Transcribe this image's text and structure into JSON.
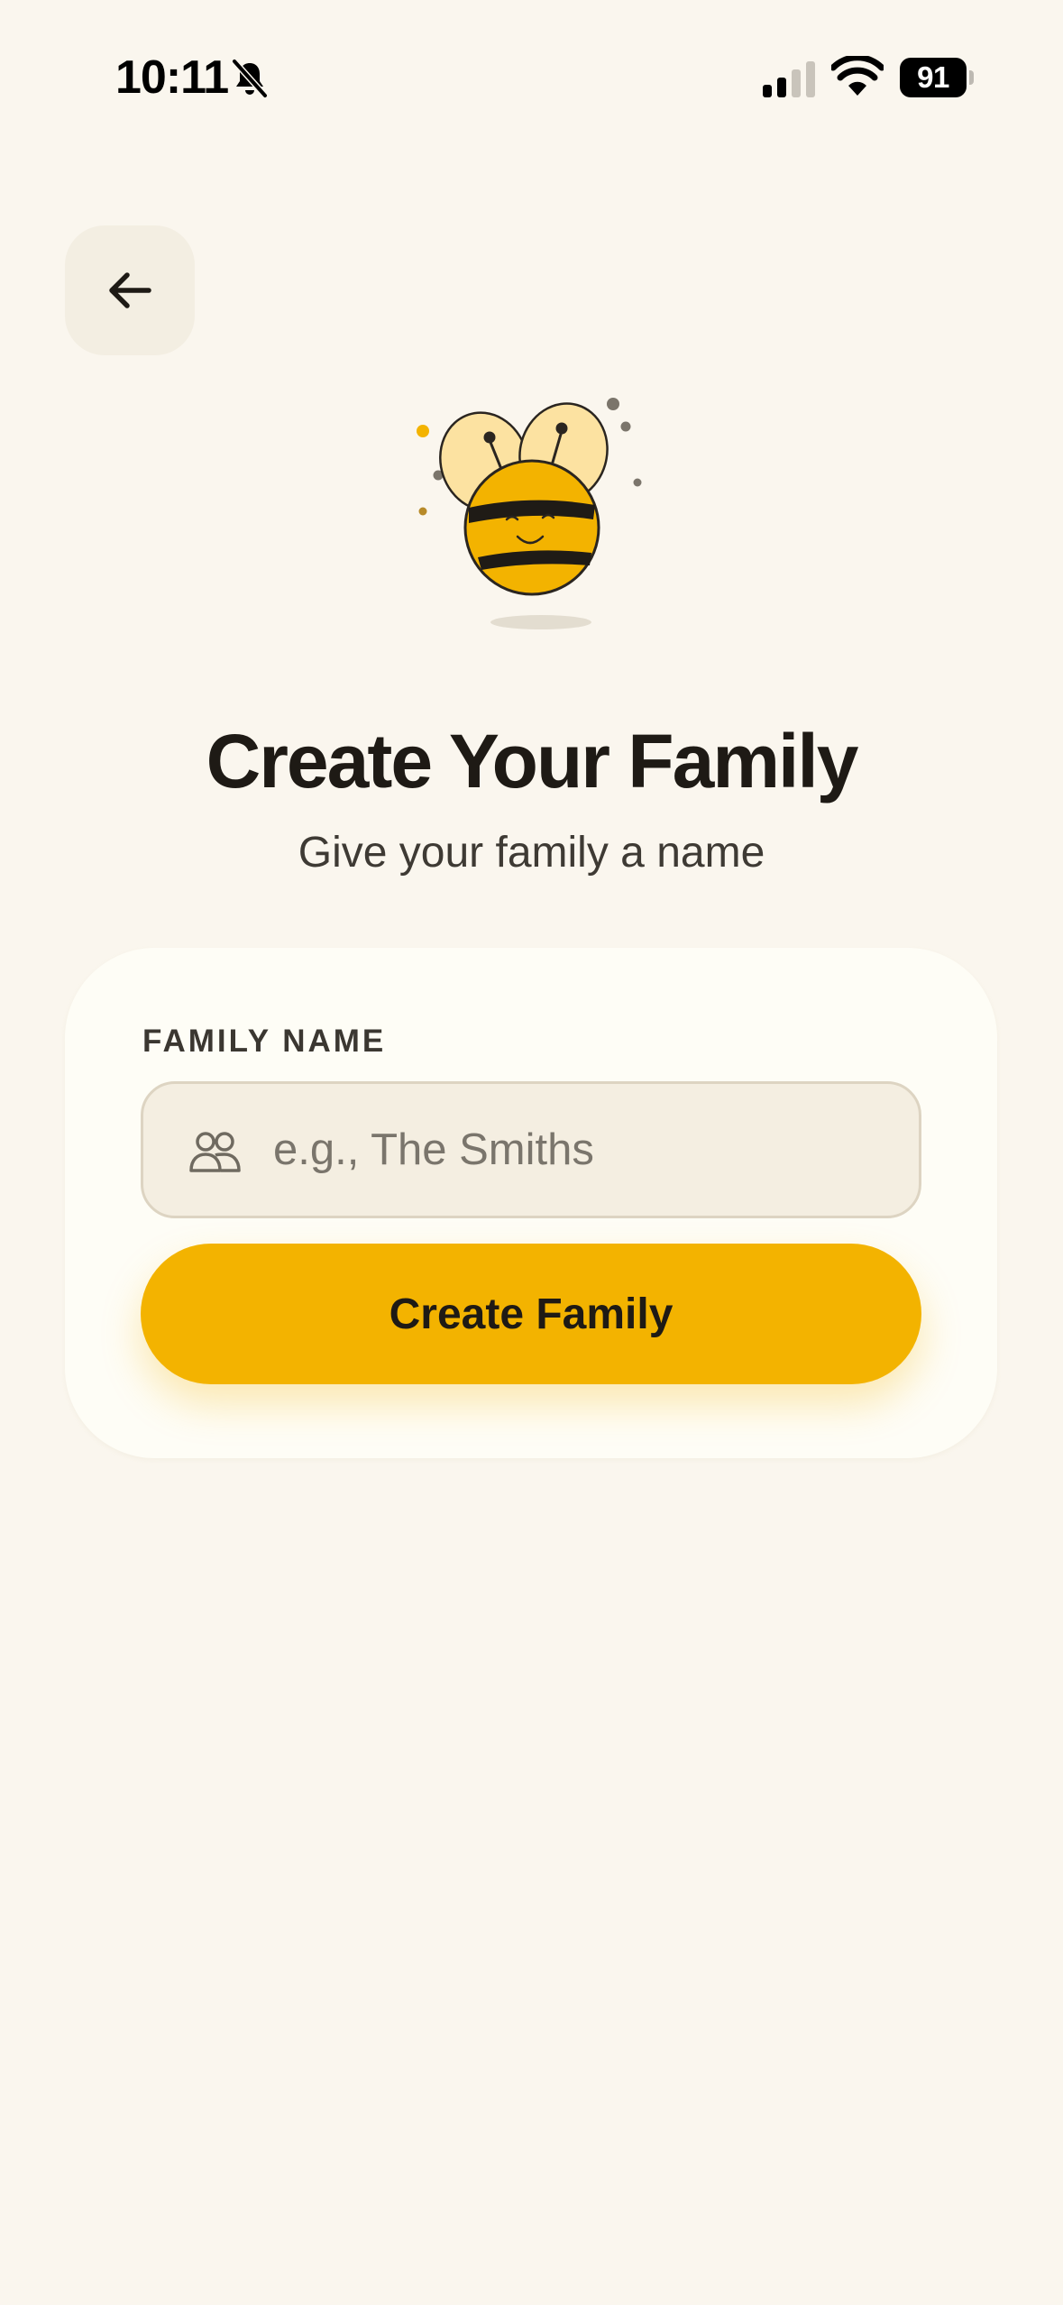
{
  "status_bar": {
    "time": "10:11",
    "battery_level": "91",
    "icons": [
      "bell-slash-icon",
      "cellular-signal-icon",
      "wifi-icon",
      "battery-icon"
    ]
  },
  "header": {
    "back_icon": "arrow-left-icon"
  },
  "mascot": {
    "icon": "bee-mascot-icon"
  },
  "page": {
    "title": "Create Your Family",
    "subtitle": "Give your family a name"
  },
  "form": {
    "field_label": "FAMILY NAME",
    "input_icon": "users-icon",
    "input_value": "",
    "input_placeholder": "e.g., The Smiths",
    "submit_label": "Create Family"
  },
  "colors": {
    "background": "#FAF6EE",
    "card": "#FEFDF6",
    "accent": "#F3B300",
    "input_background": "#F4EEE1",
    "text_primary": "#1E1A15"
  }
}
